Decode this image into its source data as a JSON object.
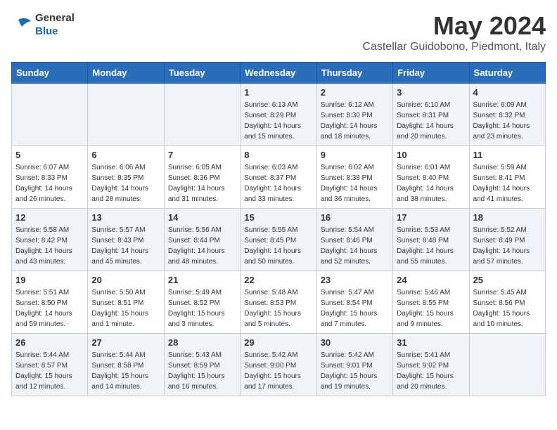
{
  "header": {
    "logo_general": "General",
    "logo_blue": "Blue",
    "title": "May 2024",
    "subtitle": "Castellar Guidobono, Piedmont, Italy"
  },
  "columns": [
    "Sunday",
    "Monday",
    "Tuesday",
    "Wednesday",
    "Thursday",
    "Friday",
    "Saturday"
  ],
  "weeks": [
    {
      "days": [
        {
          "num": "",
          "info": ""
        },
        {
          "num": "",
          "info": ""
        },
        {
          "num": "",
          "info": ""
        },
        {
          "num": "1",
          "info": "Sunrise: 6:13 AM\nSunset: 8:29 PM\nDaylight: 14 hours\nand 15 minutes."
        },
        {
          "num": "2",
          "info": "Sunrise: 6:12 AM\nSunset: 8:30 PM\nDaylight: 14 hours\nand 18 minutes."
        },
        {
          "num": "3",
          "info": "Sunrise: 6:10 AM\nSunset: 8:31 PM\nDaylight: 14 hours\nand 20 minutes."
        },
        {
          "num": "4",
          "info": "Sunrise: 6:09 AM\nSunset: 8:32 PM\nDaylight: 14 hours\nand 23 minutes."
        }
      ]
    },
    {
      "days": [
        {
          "num": "5",
          "info": "Sunrise: 6:07 AM\nSunset: 8:33 PM\nDaylight: 14 hours\nand 26 minutes."
        },
        {
          "num": "6",
          "info": "Sunrise: 6:06 AM\nSunset: 8:35 PM\nDaylight: 14 hours\nand 28 minutes."
        },
        {
          "num": "7",
          "info": "Sunrise: 6:05 AM\nSunset: 8:36 PM\nDaylight: 14 hours\nand 31 minutes."
        },
        {
          "num": "8",
          "info": "Sunrise: 6:03 AM\nSunset: 8:37 PM\nDaylight: 14 hours\nand 33 minutes."
        },
        {
          "num": "9",
          "info": "Sunrise: 6:02 AM\nSunset: 8:38 PM\nDaylight: 14 hours\nand 36 minutes."
        },
        {
          "num": "10",
          "info": "Sunrise: 6:01 AM\nSunset: 8:40 PM\nDaylight: 14 hours\nand 38 minutes."
        },
        {
          "num": "11",
          "info": "Sunrise: 5:59 AM\nSunset: 8:41 PM\nDaylight: 14 hours\nand 41 minutes."
        }
      ]
    },
    {
      "days": [
        {
          "num": "12",
          "info": "Sunrise: 5:58 AM\nSunset: 8:42 PM\nDaylight: 14 hours\nand 43 minutes."
        },
        {
          "num": "13",
          "info": "Sunrise: 5:57 AM\nSunset: 8:43 PM\nDaylight: 14 hours\nand 45 minutes."
        },
        {
          "num": "14",
          "info": "Sunrise: 5:56 AM\nSunset: 8:44 PM\nDaylight: 14 hours\nand 48 minutes."
        },
        {
          "num": "15",
          "info": "Sunrise: 5:55 AM\nSunset: 8:45 PM\nDaylight: 14 hours\nand 50 minutes."
        },
        {
          "num": "16",
          "info": "Sunrise: 5:54 AM\nSunset: 8:46 PM\nDaylight: 14 hours\nand 52 minutes."
        },
        {
          "num": "17",
          "info": "Sunrise: 5:53 AM\nSunset: 8:48 PM\nDaylight: 14 hours\nand 55 minutes."
        },
        {
          "num": "18",
          "info": "Sunrise: 5:52 AM\nSunset: 8:49 PM\nDaylight: 14 hours\nand 57 minutes."
        }
      ]
    },
    {
      "days": [
        {
          "num": "19",
          "info": "Sunrise: 5:51 AM\nSunset: 8:50 PM\nDaylight: 14 hours\nand 59 minutes."
        },
        {
          "num": "20",
          "info": "Sunrise: 5:50 AM\nSunset: 8:51 PM\nDaylight: 15 hours\nand 1 minute."
        },
        {
          "num": "21",
          "info": "Sunrise: 5:49 AM\nSunset: 8:52 PM\nDaylight: 15 hours\nand 3 minutes."
        },
        {
          "num": "22",
          "info": "Sunrise: 5:48 AM\nSunset: 8:53 PM\nDaylight: 15 hours\nand 5 minutes."
        },
        {
          "num": "23",
          "info": "Sunrise: 5:47 AM\nSunset: 8:54 PM\nDaylight: 15 hours\nand 7 minutes."
        },
        {
          "num": "24",
          "info": "Sunrise: 5:46 AM\nSunset: 8:55 PM\nDaylight: 15 hours\nand 9 minutes."
        },
        {
          "num": "25",
          "info": "Sunrise: 5:45 AM\nSunset: 8:56 PM\nDaylight: 15 hours\nand 10 minutes."
        }
      ]
    },
    {
      "days": [
        {
          "num": "26",
          "info": "Sunrise: 5:44 AM\nSunset: 8:57 PM\nDaylight: 15 hours\nand 12 minutes."
        },
        {
          "num": "27",
          "info": "Sunrise: 5:44 AM\nSunset: 8:58 PM\nDaylight: 15 hours\nand 14 minutes."
        },
        {
          "num": "28",
          "info": "Sunrise: 5:43 AM\nSunset: 8:59 PM\nDaylight: 15 hours\nand 16 minutes."
        },
        {
          "num": "29",
          "info": "Sunrise: 5:42 AM\nSunset: 9:00 PM\nDaylight: 15 hours\nand 17 minutes."
        },
        {
          "num": "30",
          "info": "Sunrise: 5:42 AM\nSunset: 9:01 PM\nDaylight: 15 hours\nand 19 minutes."
        },
        {
          "num": "31",
          "info": "Sunrise: 5:41 AM\nSunset: 9:02 PM\nDaylight: 15 hours\nand 20 minutes."
        },
        {
          "num": "",
          "info": ""
        }
      ]
    }
  ]
}
